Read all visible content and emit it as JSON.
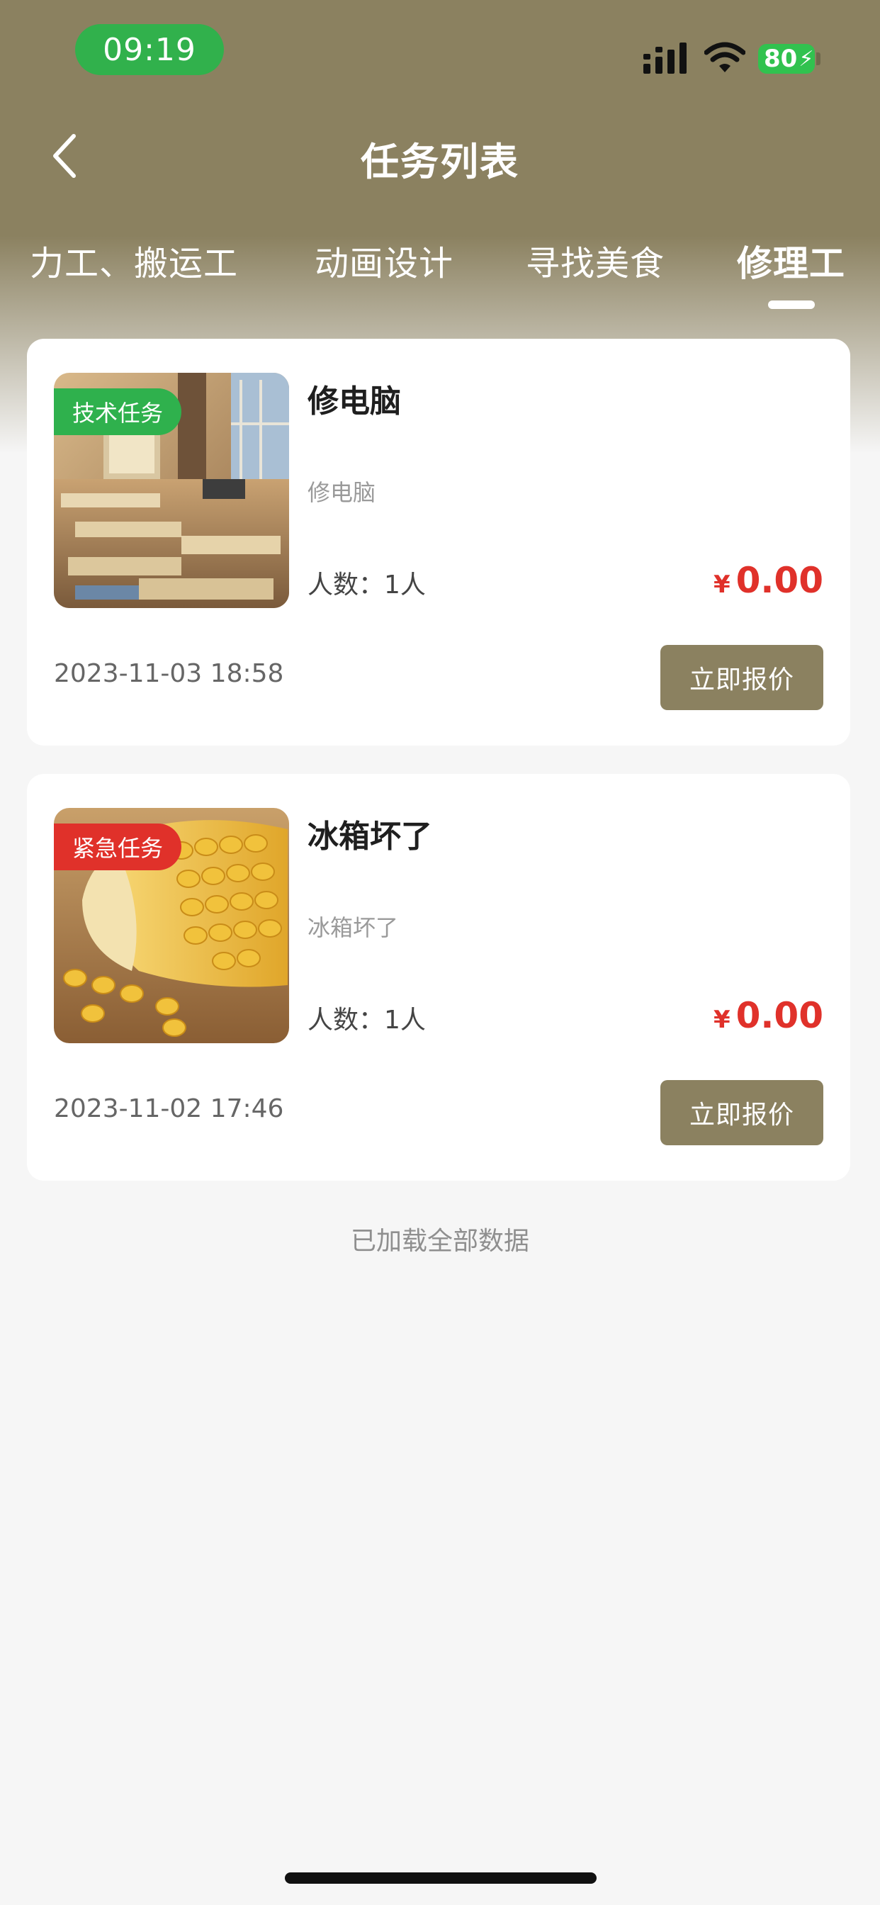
{
  "status_bar": {
    "time": "09:19",
    "battery": "80",
    "icons": [
      "cellular-signal-icon",
      "wifi-icon",
      "battery-charging-icon"
    ]
  },
  "nav": {
    "back_icon": "chevron-left-icon",
    "title": "任务列表"
  },
  "tabs": [
    {
      "label": "力工、搬运工",
      "active": false
    },
    {
      "label": "动画设计",
      "active": false
    },
    {
      "label": "寻找美食",
      "active": false
    },
    {
      "label": "修理工",
      "active": true
    }
  ],
  "tasks": [
    {
      "badge": "技术任务",
      "badge_color": "#2fb14d",
      "title": "修电脑",
      "description": "修电脑",
      "people": "人数：1人",
      "currency": "¥",
      "price": "0.00",
      "date": "2023-11-03 18:58",
      "action": "立即报价",
      "image": "classroom-photo"
    },
    {
      "badge": "紧急任务",
      "badge_color": "#e0312a",
      "title": "冰箱坏了",
      "description": "冰箱坏了",
      "people": "人数：1人",
      "currency": "¥",
      "price": "0.00",
      "date": "2023-11-02 17:46",
      "action": "立即报价",
      "image": "corn-photo"
    }
  ],
  "footer_text": "已加载全部数据",
  "colors": {
    "accent": "#8b8160",
    "price": "#e0312a",
    "background": "#f6f6f6"
  }
}
